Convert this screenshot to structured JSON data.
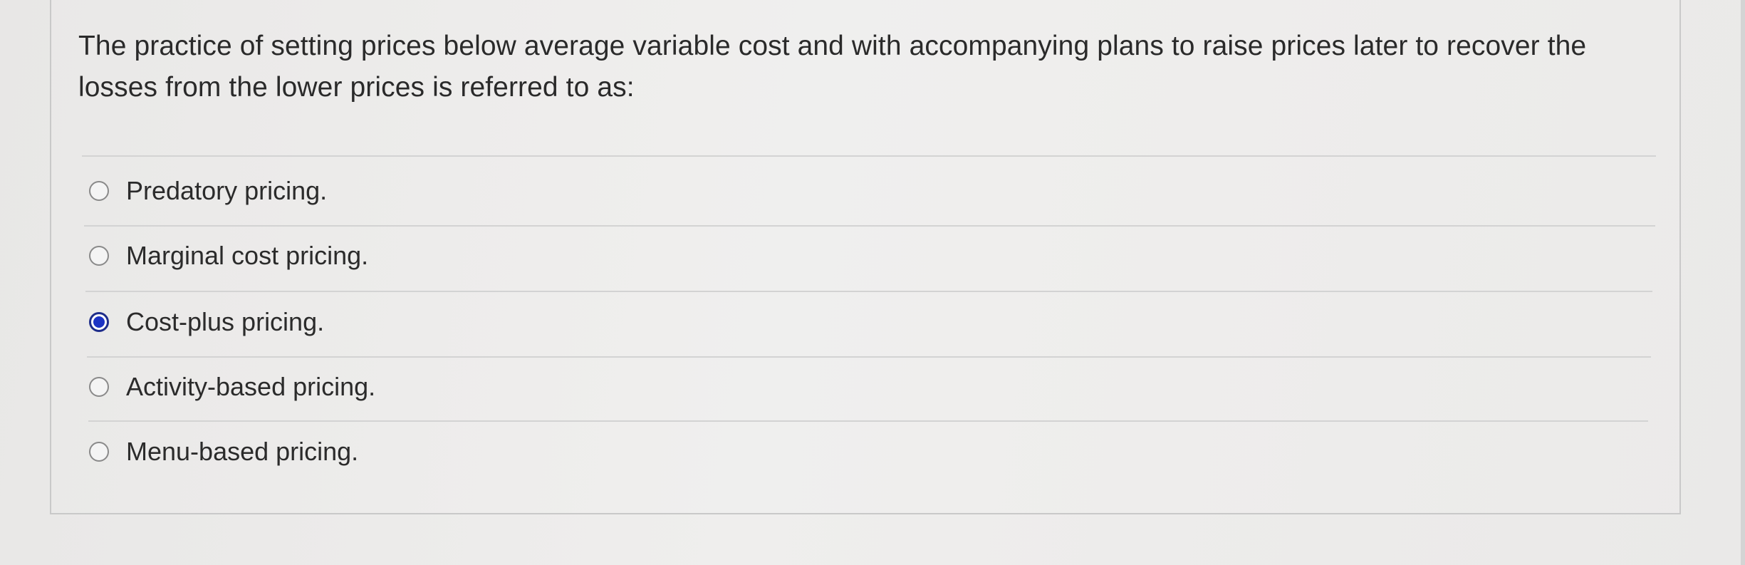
{
  "question": {
    "text": "The practice of setting prices below average variable cost and with accompanying plans to raise prices later to recover the losses from the lower prices is referred to as:"
  },
  "options": [
    {
      "label": "Predatory pricing.",
      "selected": false
    },
    {
      "label": "Marginal cost pricing.",
      "selected": false
    },
    {
      "label": "Cost-plus pricing.",
      "selected": true
    },
    {
      "label": "Activity-based pricing.",
      "selected": false
    },
    {
      "label": "Menu-based pricing.",
      "selected": false
    }
  ],
  "colors": {
    "selected_radio": "#1c33c4",
    "radio_border": "#8a8a8a",
    "divider": "#d3d3d3"
  }
}
